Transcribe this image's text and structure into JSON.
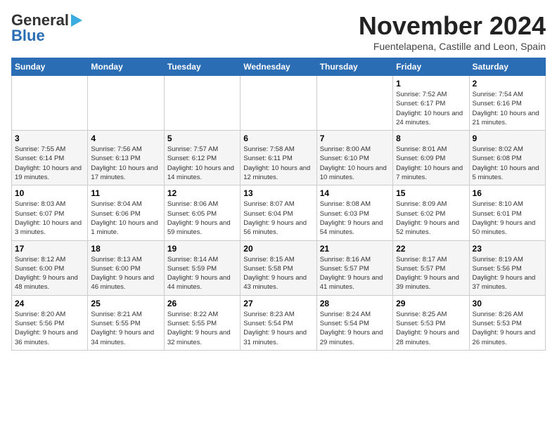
{
  "header": {
    "logo_general": "General",
    "logo_blue": "Blue",
    "month": "November 2024",
    "location": "Fuentelapena, Castille and Leon, Spain"
  },
  "days_of_week": [
    "Sunday",
    "Monday",
    "Tuesday",
    "Wednesday",
    "Thursday",
    "Friday",
    "Saturday"
  ],
  "weeks": [
    [
      {
        "day": "",
        "info": ""
      },
      {
        "day": "",
        "info": ""
      },
      {
        "day": "",
        "info": ""
      },
      {
        "day": "",
        "info": ""
      },
      {
        "day": "",
        "info": ""
      },
      {
        "day": "1",
        "info": "Sunrise: 7:52 AM\nSunset: 6:17 PM\nDaylight: 10 hours and 24 minutes."
      },
      {
        "day": "2",
        "info": "Sunrise: 7:54 AM\nSunset: 6:16 PM\nDaylight: 10 hours and 21 minutes."
      }
    ],
    [
      {
        "day": "3",
        "info": "Sunrise: 7:55 AM\nSunset: 6:14 PM\nDaylight: 10 hours and 19 minutes."
      },
      {
        "day": "4",
        "info": "Sunrise: 7:56 AM\nSunset: 6:13 PM\nDaylight: 10 hours and 17 minutes."
      },
      {
        "day": "5",
        "info": "Sunrise: 7:57 AM\nSunset: 6:12 PM\nDaylight: 10 hours and 14 minutes."
      },
      {
        "day": "6",
        "info": "Sunrise: 7:58 AM\nSunset: 6:11 PM\nDaylight: 10 hours and 12 minutes."
      },
      {
        "day": "7",
        "info": "Sunrise: 8:00 AM\nSunset: 6:10 PM\nDaylight: 10 hours and 10 minutes."
      },
      {
        "day": "8",
        "info": "Sunrise: 8:01 AM\nSunset: 6:09 PM\nDaylight: 10 hours and 7 minutes."
      },
      {
        "day": "9",
        "info": "Sunrise: 8:02 AM\nSunset: 6:08 PM\nDaylight: 10 hours and 5 minutes."
      }
    ],
    [
      {
        "day": "10",
        "info": "Sunrise: 8:03 AM\nSunset: 6:07 PM\nDaylight: 10 hours and 3 minutes."
      },
      {
        "day": "11",
        "info": "Sunrise: 8:04 AM\nSunset: 6:06 PM\nDaylight: 10 hours and 1 minute."
      },
      {
        "day": "12",
        "info": "Sunrise: 8:06 AM\nSunset: 6:05 PM\nDaylight: 9 hours and 59 minutes."
      },
      {
        "day": "13",
        "info": "Sunrise: 8:07 AM\nSunset: 6:04 PM\nDaylight: 9 hours and 56 minutes."
      },
      {
        "day": "14",
        "info": "Sunrise: 8:08 AM\nSunset: 6:03 PM\nDaylight: 9 hours and 54 minutes."
      },
      {
        "day": "15",
        "info": "Sunrise: 8:09 AM\nSunset: 6:02 PM\nDaylight: 9 hours and 52 minutes."
      },
      {
        "day": "16",
        "info": "Sunrise: 8:10 AM\nSunset: 6:01 PM\nDaylight: 9 hours and 50 minutes."
      }
    ],
    [
      {
        "day": "17",
        "info": "Sunrise: 8:12 AM\nSunset: 6:00 PM\nDaylight: 9 hours and 48 minutes."
      },
      {
        "day": "18",
        "info": "Sunrise: 8:13 AM\nSunset: 6:00 PM\nDaylight: 9 hours and 46 minutes."
      },
      {
        "day": "19",
        "info": "Sunrise: 8:14 AM\nSunset: 5:59 PM\nDaylight: 9 hours and 44 minutes."
      },
      {
        "day": "20",
        "info": "Sunrise: 8:15 AM\nSunset: 5:58 PM\nDaylight: 9 hours and 43 minutes."
      },
      {
        "day": "21",
        "info": "Sunrise: 8:16 AM\nSunset: 5:57 PM\nDaylight: 9 hours and 41 minutes."
      },
      {
        "day": "22",
        "info": "Sunrise: 8:17 AM\nSunset: 5:57 PM\nDaylight: 9 hours and 39 minutes."
      },
      {
        "day": "23",
        "info": "Sunrise: 8:19 AM\nSunset: 5:56 PM\nDaylight: 9 hours and 37 minutes."
      }
    ],
    [
      {
        "day": "24",
        "info": "Sunrise: 8:20 AM\nSunset: 5:56 PM\nDaylight: 9 hours and 36 minutes."
      },
      {
        "day": "25",
        "info": "Sunrise: 8:21 AM\nSunset: 5:55 PM\nDaylight: 9 hours and 34 minutes."
      },
      {
        "day": "26",
        "info": "Sunrise: 8:22 AM\nSunset: 5:55 PM\nDaylight: 9 hours and 32 minutes."
      },
      {
        "day": "27",
        "info": "Sunrise: 8:23 AM\nSunset: 5:54 PM\nDaylight: 9 hours and 31 minutes."
      },
      {
        "day": "28",
        "info": "Sunrise: 8:24 AM\nSunset: 5:54 PM\nDaylight: 9 hours and 29 minutes."
      },
      {
        "day": "29",
        "info": "Sunrise: 8:25 AM\nSunset: 5:53 PM\nDaylight: 9 hours and 28 minutes."
      },
      {
        "day": "30",
        "info": "Sunrise: 8:26 AM\nSunset: 5:53 PM\nDaylight: 9 hours and 26 minutes."
      }
    ]
  ]
}
